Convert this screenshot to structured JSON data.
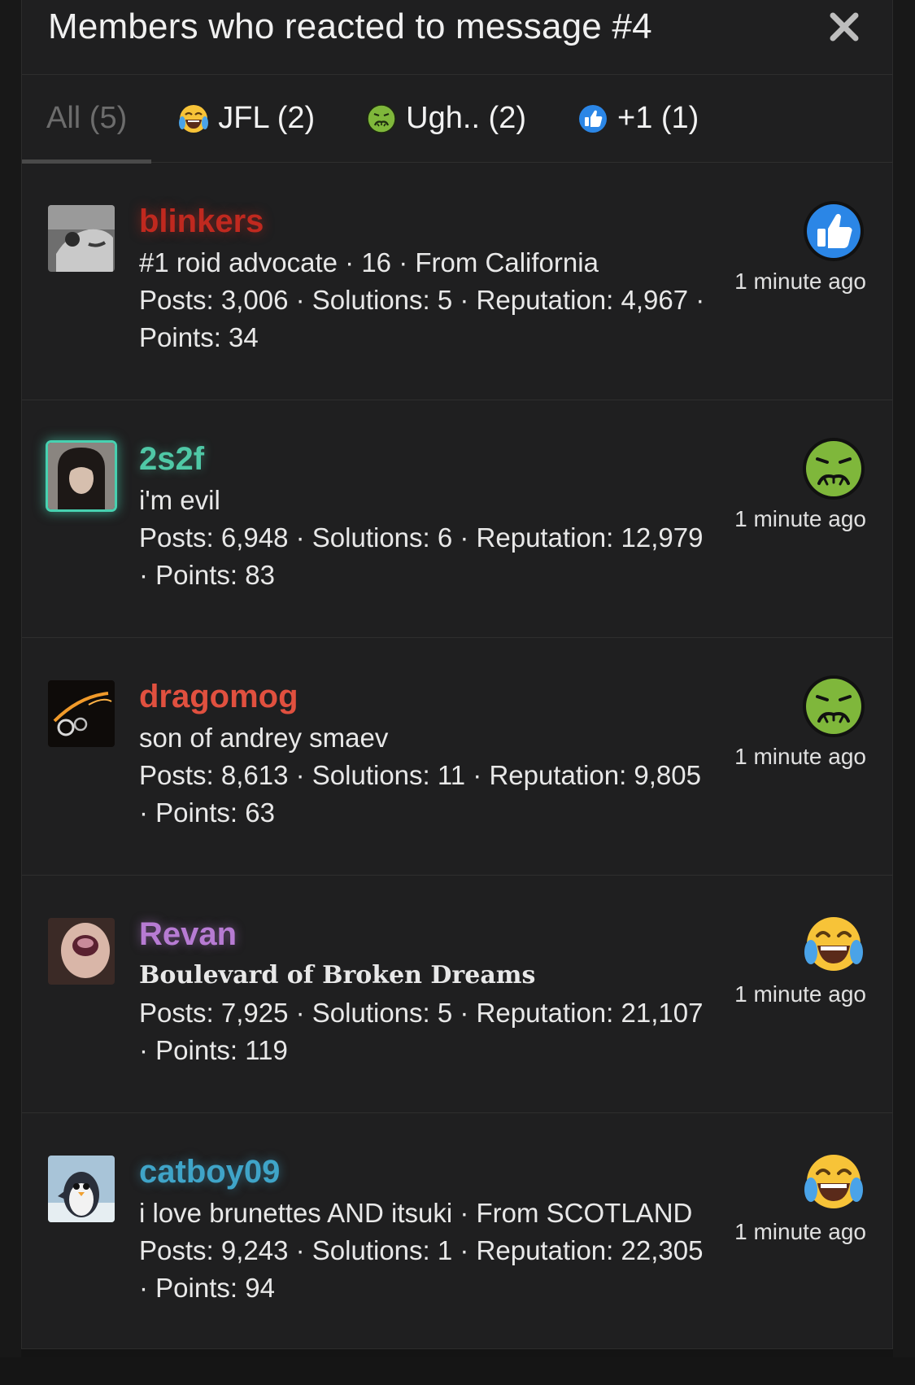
{
  "modal": {
    "title": "Members who reacted to message #4"
  },
  "tabs": [
    {
      "label": "All (5)",
      "icon": "none",
      "active": true
    },
    {
      "label": "JFL (2)",
      "icon": "joy-emoji-icon"
    },
    {
      "label": "Ugh.. (2)",
      "icon": "nauseated-emoji-icon"
    },
    {
      "label": "+1 (1)",
      "icon": "thumbs-up-icon"
    }
  ],
  "colors": {
    "blinkers": "#c0291f",
    "2s2f": "#4fc8a6",
    "dragomog": "#e0503f",
    "revan": "#b77bd3",
    "catboy09": "#3fa4c8"
  },
  "members": [
    {
      "username": "blinkers",
      "title": "#1 roid advocate · 16 · From California",
      "stats": "Posts: 3,006 · Solutions: 5 · Reputation: 4,967 · Points: 34",
      "reaction": "thumbs-up-icon",
      "time": "1 minute ago"
    },
    {
      "username": "2s2f",
      "title": "i'm evil",
      "stats": "Posts: 6,948 · Solutions: 6 · Reputation: 12,979 · Points: 83",
      "reaction": "nauseated-emoji-icon",
      "time": "1 minute ago"
    },
    {
      "username": "dragomog",
      "title": "son of andrey smaev",
      "stats": "Posts: 8,613 · Solutions: 11 · Reputation: 9,805 · Points: 63",
      "reaction": "nauseated-emoji-icon",
      "time": "1 minute ago"
    },
    {
      "username": "Revan",
      "title": "Boulevard of Broken Dreams",
      "stats": "Posts: 7,925 · Solutions: 5 · Reputation: 21,107 · Points: 119",
      "reaction": "joy-emoji-icon",
      "time": "1 minute ago"
    },
    {
      "username": "catboy09",
      "title": "i love brunettes AND itsuki · From SCOTLAND",
      "stats": "Posts: 9,243 · Solutions: 1 · Reputation: 22,305 · Points: 94",
      "reaction": "joy-emoji-icon",
      "time": "1 minute ago"
    }
  ]
}
